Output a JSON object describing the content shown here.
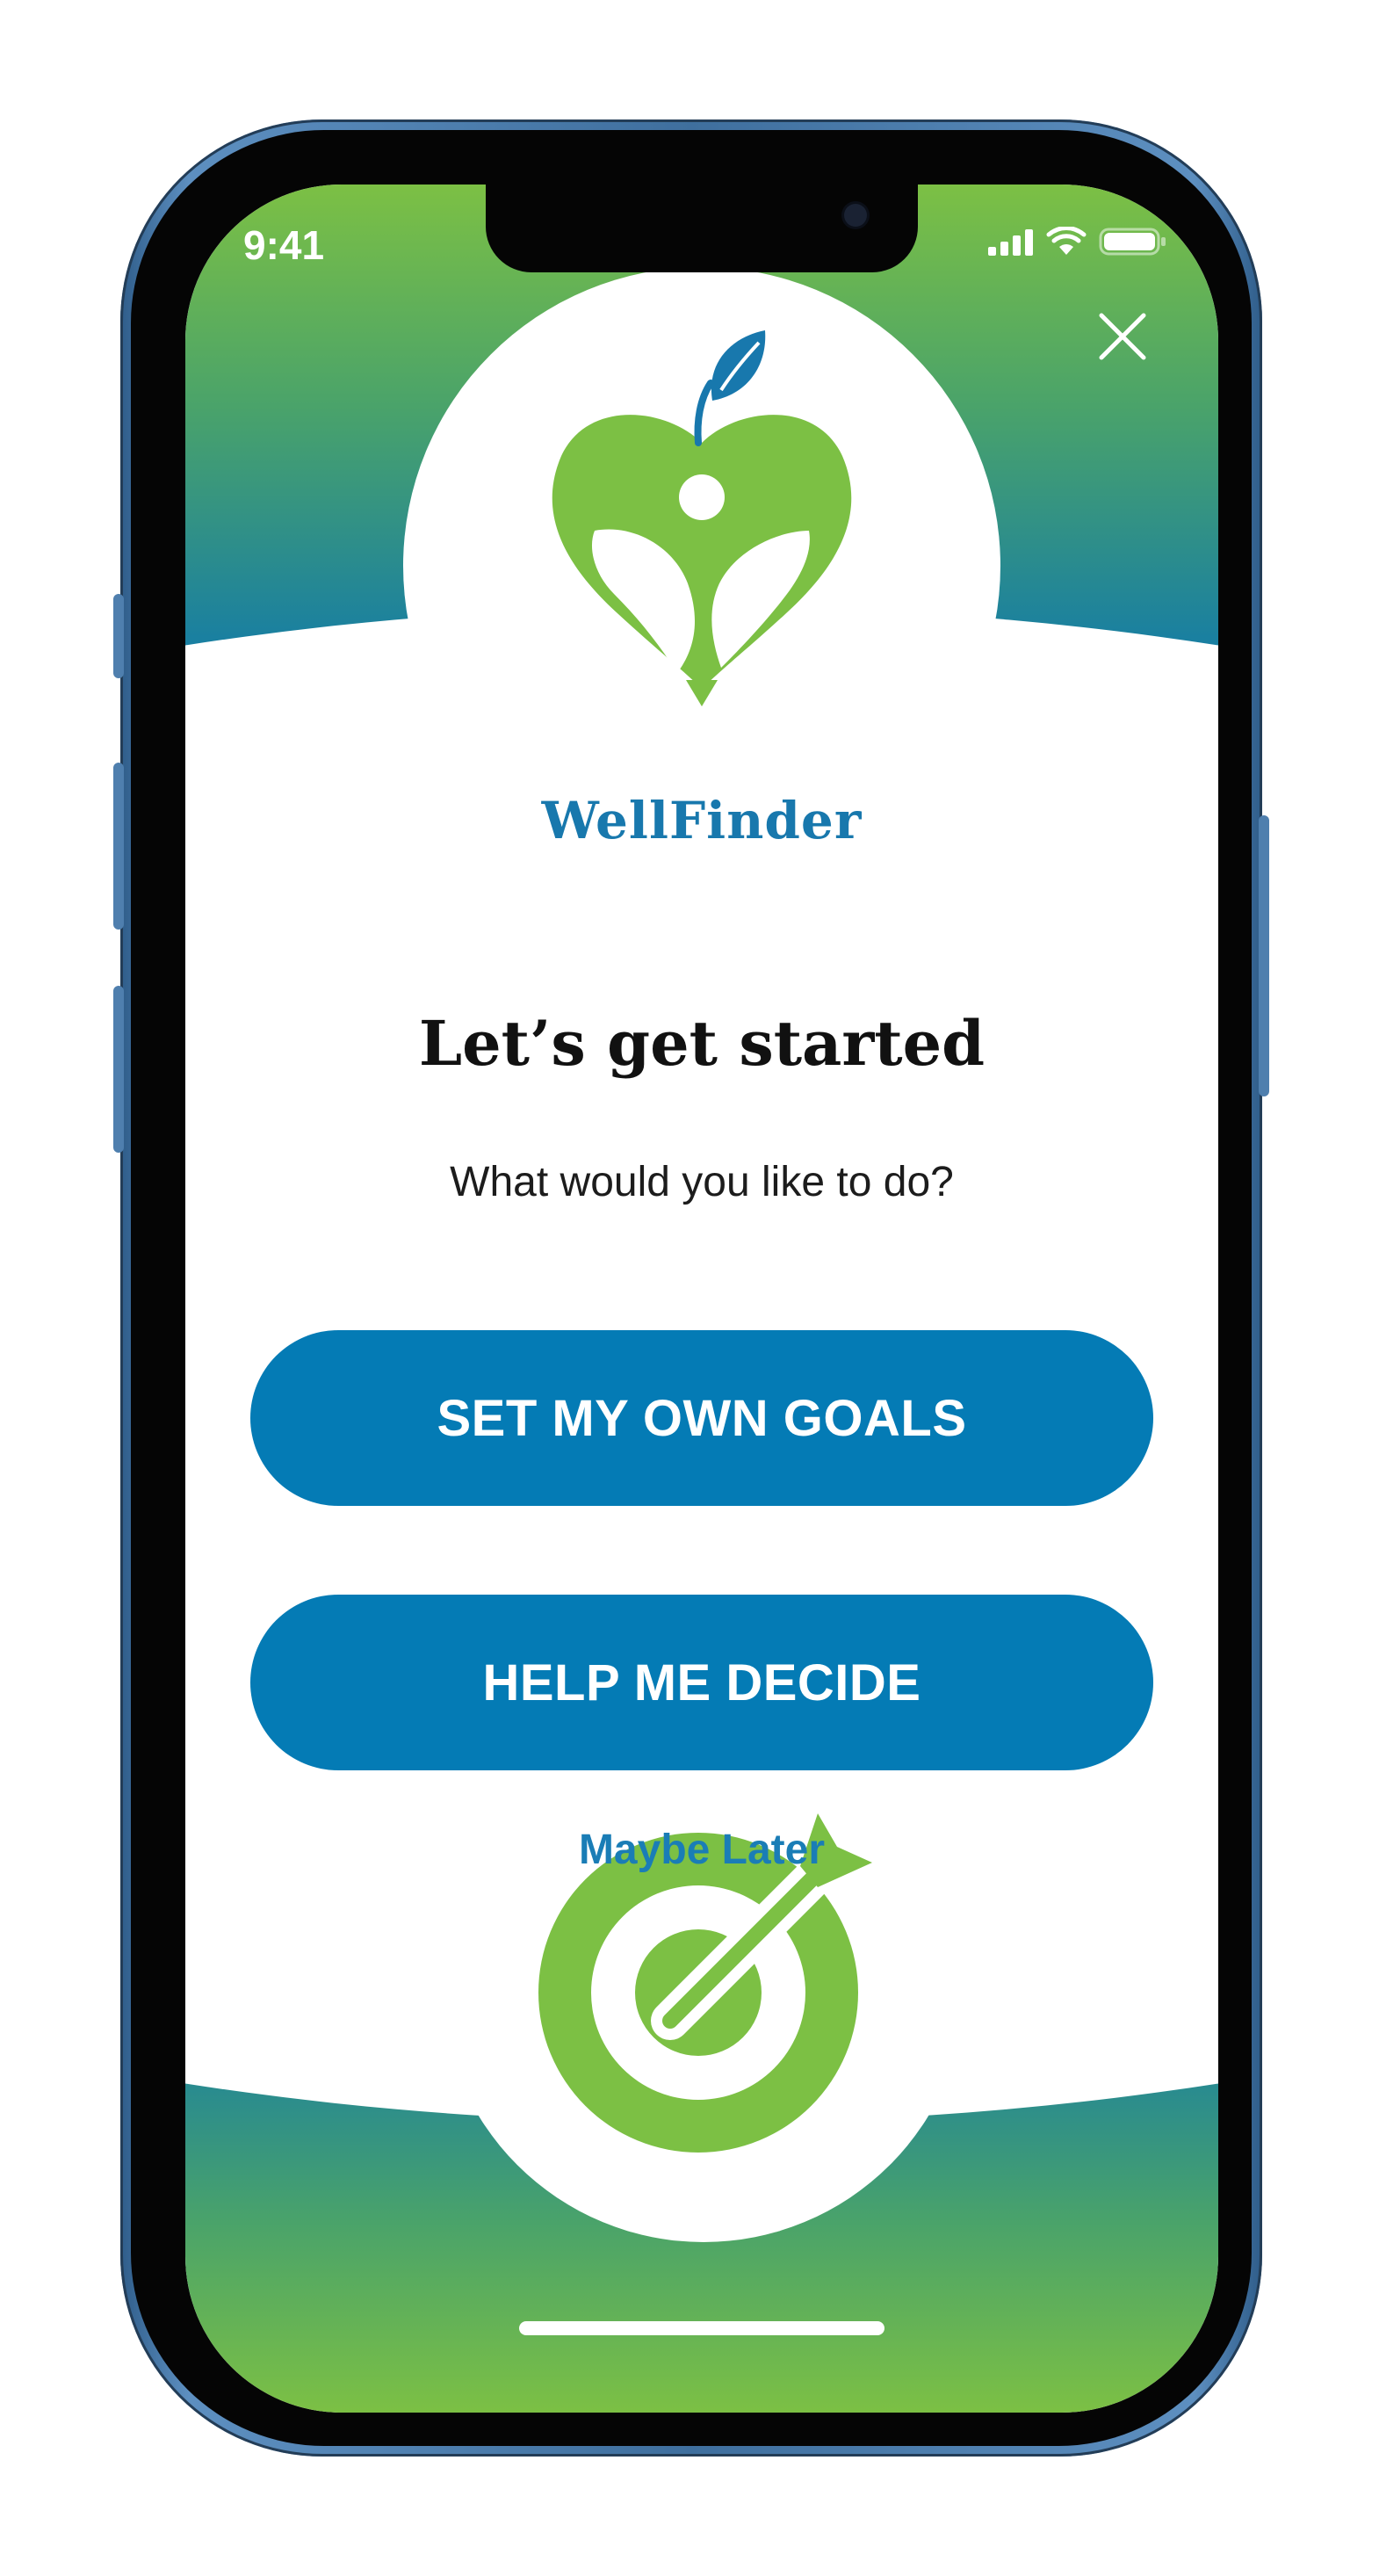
{
  "status_bar": {
    "time": "9:41",
    "icons": [
      "signal-icon",
      "wifi-icon",
      "battery-icon"
    ]
  },
  "close_icon": "close-icon",
  "brand": {
    "name": "WellFinder",
    "logo_icon": "heart-apple-person-logo"
  },
  "main": {
    "title": "Let’s get started",
    "subtitle": "What would you like to do?",
    "primary_button": "SET MY OWN GOALS",
    "secondary_button": "HELP ME DECIDE",
    "skip_link": "Maybe Later"
  },
  "footer_icon": "target-arrow-icon",
  "colors": {
    "brand_blue": "#047bb5",
    "brand_green": "#7cc044",
    "text_dark": "#111111",
    "link_blue": "#1a7db6"
  }
}
